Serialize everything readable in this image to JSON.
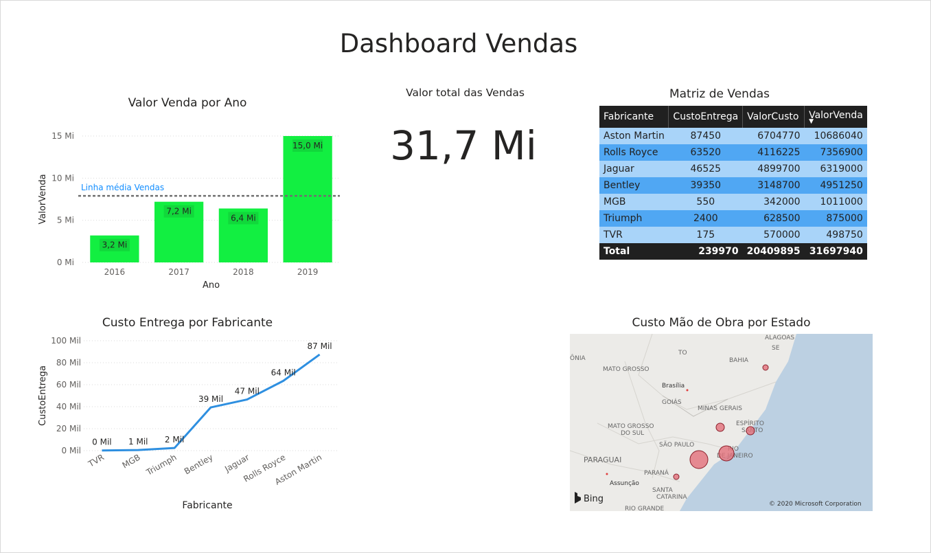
{
  "page": {
    "title": "Dashboard Vendas"
  },
  "bar_visual": {
    "title": "Valor Venda por Ano",
    "avg_line_label": "Linha média Vendas"
  },
  "kpi": {
    "title": "Valor total das Vendas",
    "value": "31,7 Mi"
  },
  "matrix": {
    "title": "Matriz de Vendas",
    "headers": [
      "Fabricante",
      "CustoEntrega",
      "ValorCusto",
      "ValorVenda"
    ],
    "sort_indicator": "▼",
    "rows": [
      [
        "Aston Martin",
        "87450",
        "6704770",
        "10686040"
      ],
      [
        "Rolls Royce",
        "63520",
        "4116225",
        "7356900"
      ],
      [
        "Jaguar",
        "46525",
        "4899700",
        "6319000"
      ],
      [
        "Bentley",
        "39350",
        "3148700",
        "4951250"
      ],
      [
        "MGB",
        "550",
        "342000",
        "1011000"
      ],
      [
        "Triumph",
        "2400",
        "628500",
        "875000"
      ],
      [
        "TVR",
        "175",
        "570000",
        "498750"
      ]
    ],
    "total": [
      "Total",
      "239970",
      "20409895",
      "31697940"
    ]
  },
  "line_visual": {
    "title": "Custo Entrega por Fabricante"
  },
  "map_visual": {
    "title": "Custo Mão de Obra por Estado",
    "labels": [
      "ALAGOAS",
      "SE",
      "TO",
      "BAHIA",
      "ÔNIA",
      "MATO GROSSO",
      "Brasília",
      "GOIÁS",
      "MINAS GERAIS",
      "ESPÍRITO",
      "SANTO",
      "MATO GROSSO",
      "DO SUL",
      "SÃO PAULO",
      "RIO",
      "DE JANEIRO",
      "PARAGUAI",
      "PARANÁ",
      "Assunção",
      "SANTA",
      "CATARINA",
      "RIO GRANDE"
    ],
    "bing_label": "Bing",
    "copyright": "© 2020 Microsoft Corporation"
  },
  "colors": {
    "bar": "#12ef41",
    "line": "#2e8fe0",
    "avg_line": "#707070",
    "avg_label": "#118dff",
    "map_land": "#ecebe8",
    "map_sea": "#bcd0e2",
    "bubble": "#e3707a"
  },
  "chart_data": [
    {
      "type": "bar",
      "title": "Valor Venda por Ano",
      "xlabel": "Ano",
      "ylabel": "ValorVenda",
      "categories": [
        "2016",
        "2017",
        "2018",
        "2019"
      ],
      "values": [
        3.2,
        7.2,
        6.4,
        15.0
      ],
      "data_labels": [
        "3,2 Mi",
        "7,2 Mi",
        "6,4 Mi",
        "15,0 Mi"
      ],
      "yticks": [
        0,
        5,
        10,
        15
      ],
      "ytick_labels": [
        "0 Mi",
        "5 Mi",
        "10 Mi",
        "15 Mi"
      ],
      "ylim": [
        0,
        15
      ],
      "average_line": {
        "value": 7.9,
        "label": "Linha média Vendas"
      },
      "grid": true
    },
    {
      "type": "line",
      "title": "Custo Entrega por Fabricante",
      "xlabel": "Fabricante",
      "ylabel": "CustoEntrega",
      "categories": [
        "TVR",
        "MGB",
        "Triumph",
        "Bentley",
        "Jaguar",
        "Rolls Royce",
        "Aston Martin"
      ],
      "values": [
        0.175,
        0.55,
        2.4,
        39.35,
        46.525,
        63.52,
        87.45
      ],
      "data_labels": [
        "0 Mil",
        "1 Mil",
        "2 Mil",
        "39 Mil",
        "47 Mil",
        "64 Mil",
        "87 Mil"
      ],
      "yticks": [
        0,
        20,
        40,
        60,
        80,
        100
      ],
      "ytick_labels": [
        "0 Mil",
        "20 Mil",
        "40 Mil",
        "60 Mil",
        "80 Mil",
        "100 Mil"
      ],
      "ylim": [
        0,
        100
      ],
      "grid": true
    }
  ]
}
